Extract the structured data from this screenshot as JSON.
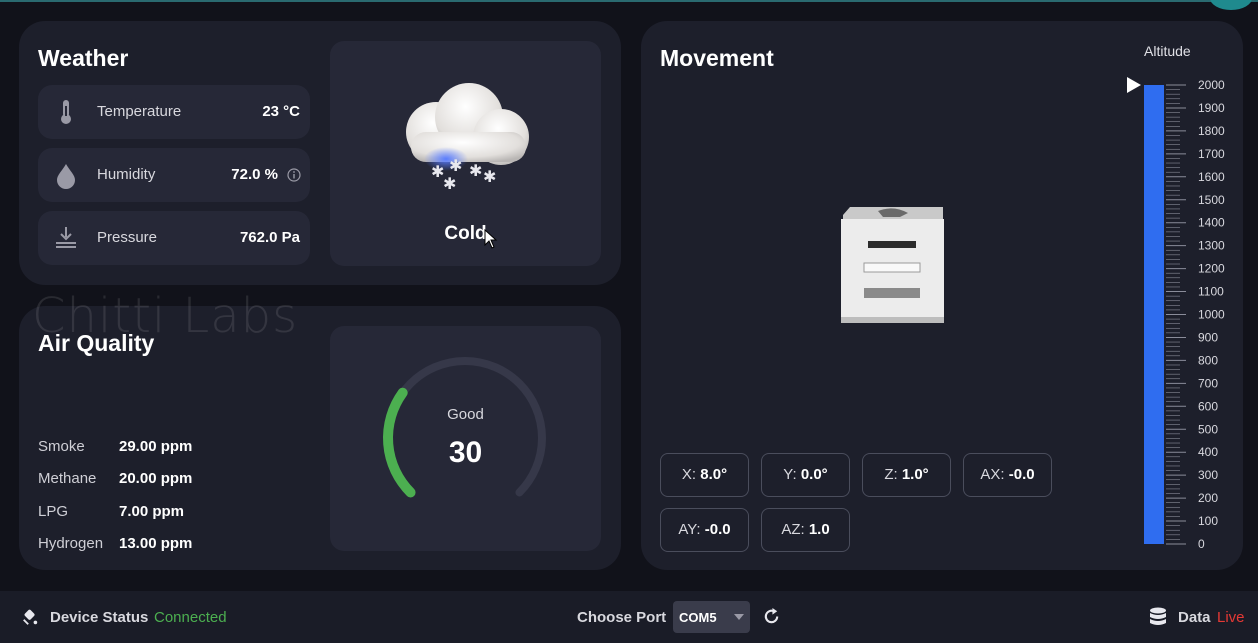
{
  "watermark": "Chitti Labs",
  "weather": {
    "title": "Weather",
    "rows": [
      {
        "label": "Temperature",
        "value": "23 °C"
      },
      {
        "label": "Humidity",
        "value": "72.0 %"
      },
      {
        "label": "Pressure",
        "value": "762.0 Pa"
      }
    ],
    "condition": "Cold"
  },
  "air_quality": {
    "title": "Air Quality",
    "gauge_label": "Good",
    "gauge_value": "30",
    "gauge_fraction": 0.3,
    "gauge_color": "#4caf50",
    "items": [
      {
        "label": "Smoke",
        "value": "29.00 ppm"
      },
      {
        "label": "Methane",
        "value": "20.00 ppm"
      },
      {
        "label": "LPG",
        "value": "7.00 ppm"
      },
      {
        "label": "Hydrogen",
        "value": "13.00 ppm"
      }
    ]
  },
  "movement": {
    "title": "Movement",
    "chips": [
      {
        "label": "X:",
        "value": "8.0°"
      },
      {
        "label": "Y:",
        "value": "0.0°"
      },
      {
        "label": "Z:",
        "value": "1.0°"
      },
      {
        "label": "AX:",
        "value": "-0.0"
      },
      {
        "label": "AY:",
        "value": "-0.0"
      },
      {
        "label": "AZ:",
        "value": "1.0"
      }
    ],
    "altitude": {
      "title": "Altitude",
      "ticks": [
        "2000",
        "1900",
        "1800",
        "1700",
        "1600",
        "1500",
        "1400",
        "1300",
        "1200",
        "1100",
        "1000",
        "900",
        "800",
        "700",
        "600",
        "500",
        "400",
        "300",
        "200",
        "100",
        "0"
      ],
      "value": 2000,
      "max": 2000,
      "bar_color": "#2f6df0"
    }
  },
  "footer": {
    "device_status_label": "Device Status",
    "device_status_value": "Connected",
    "status_color": "#4caf50",
    "choose_port_label": "Choose Port",
    "port_value": "COM5",
    "data_label": "Data",
    "data_state": "Live",
    "live_color": "#e53935"
  }
}
